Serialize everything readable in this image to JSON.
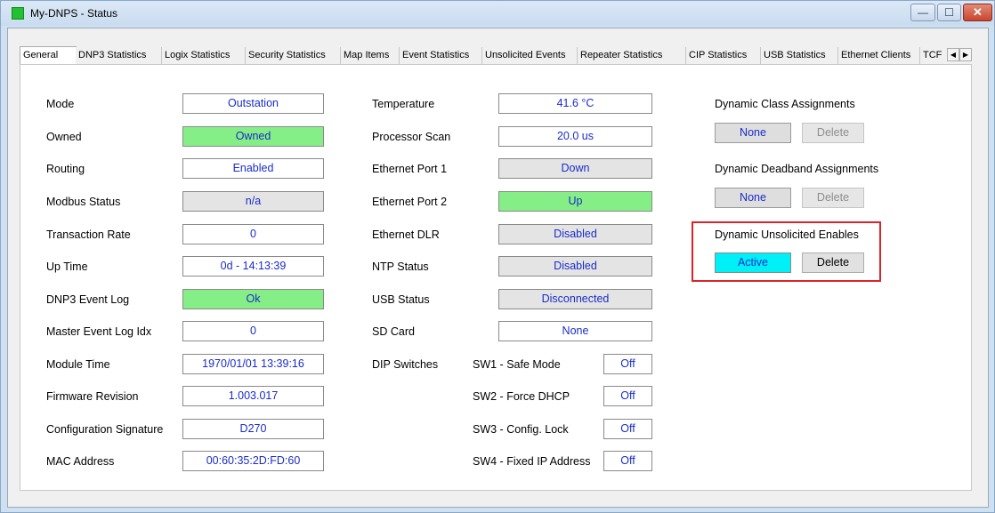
{
  "window": {
    "title": "My-DNPS - Status",
    "controls": {
      "minimize": "—",
      "maximize": "☐",
      "close": "✕"
    },
    "icon_color": "#22c032"
  },
  "tabs": [
    "General",
    "DNP3 Statistics",
    "Logix Statistics",
    "Security Statistics",
    "Map Items",
    "Event Statistics",
    "Unsolicited Events",
    "Repeater Statistics",
    "CIP Statistics",
    "USB Statistics",
    "Ethernet Clients",
    "TCF"
  ],
  "tab_scroll": {
    "left": "◀",
    "right": "▶"
  },
  "left_fields": [
    {
      "label": "Mode",
      "value": "Outstation"
    },
    {
      "label": "Owned",
      "value": "Owned"
    },
    {
      "label": "Routing",
      "value": "Enabled"
    },
    {
      "label": "Modbus Status",
      "value": "n/a"
    },
    {
      "label": "Transaction Rate",
      "value": "0"
    },
    {
      "label": "Up Time",
      "value": "0d - 14:13:39"
    },
    {
      "label": "DNP3 Event Log",
      "value": "Ok"
    },
    {
      "label": "Master Event Log Idx",
      "value": "0"
    },
    {
      "label": "Module Time",
      "value": "1970/01/01 13:39:16"
    },
    {
      "label": "Firmware Revision",
      "value": "1.003.017"
    },
    {
      "label": "Configuration Signature",
      "value": "D270"
    },
    {
      "label": "MAC Address",
      "value": "00:60:35:2D:FD:60"
    }
  ],
  "middle_fields": [
    {
      "label": "Temperature",
      "value": "41.6 °C"
    },
    {
      "label": "Processor Scan",
      "value": "20.0 us"
    },
    {
      "label": "Ethernet Port 1",
      "value": "Down"
    },
    {
      "label": "Ethernet Port 2",
      "value": "Up"
    },
    {
      "label": "Ethernet DLR",
      "value": "Disabled"
    },
    {
      "label": "NTP Status",
      "value": "Disabled"
    },
    {
      "label": "USB Status",
      "value": "Disconnected"
    },
    {
      "label": "SD Card",
      "value": "None"
    }
  ],
  "dip": {
    "label": "DIP Switches",
    "switches": [
      {
        "label": "SW1 - Safe Mode",
        "value": "Off"
      },
      {
        "label": "SW2 - Force DHCP",
        "value": "Off"
      },
      {
        "label": "SW3 - Config. Lock",
        "value": "Off"
      },
      {
        "label": "SW4 - Fixed IP Address",
        "value": "Off"
      }
    ]
  },
  "dynamic": {
    "class": {
      "title": "Dynamic Class Assignments",
      "state": "None",
      "delete": "Delete"
    },
    "deadband": {
      "title": "Dynamic Deadband Assignments",
      "state": "None",
      "delete": "Delete"
    },
    "unsolicited": {
      "title": "Dynamic Unsolicited Enables",
      "state": "Active",
      "delete": "Delete"
    }
  },
  "colors": {
    "value_text": "#1a2ccc",
    "ok_green": "#86ee86",
    "active_cyan": "#00f0f8",
    "highlight_red": "#d9242b"
  }
}
